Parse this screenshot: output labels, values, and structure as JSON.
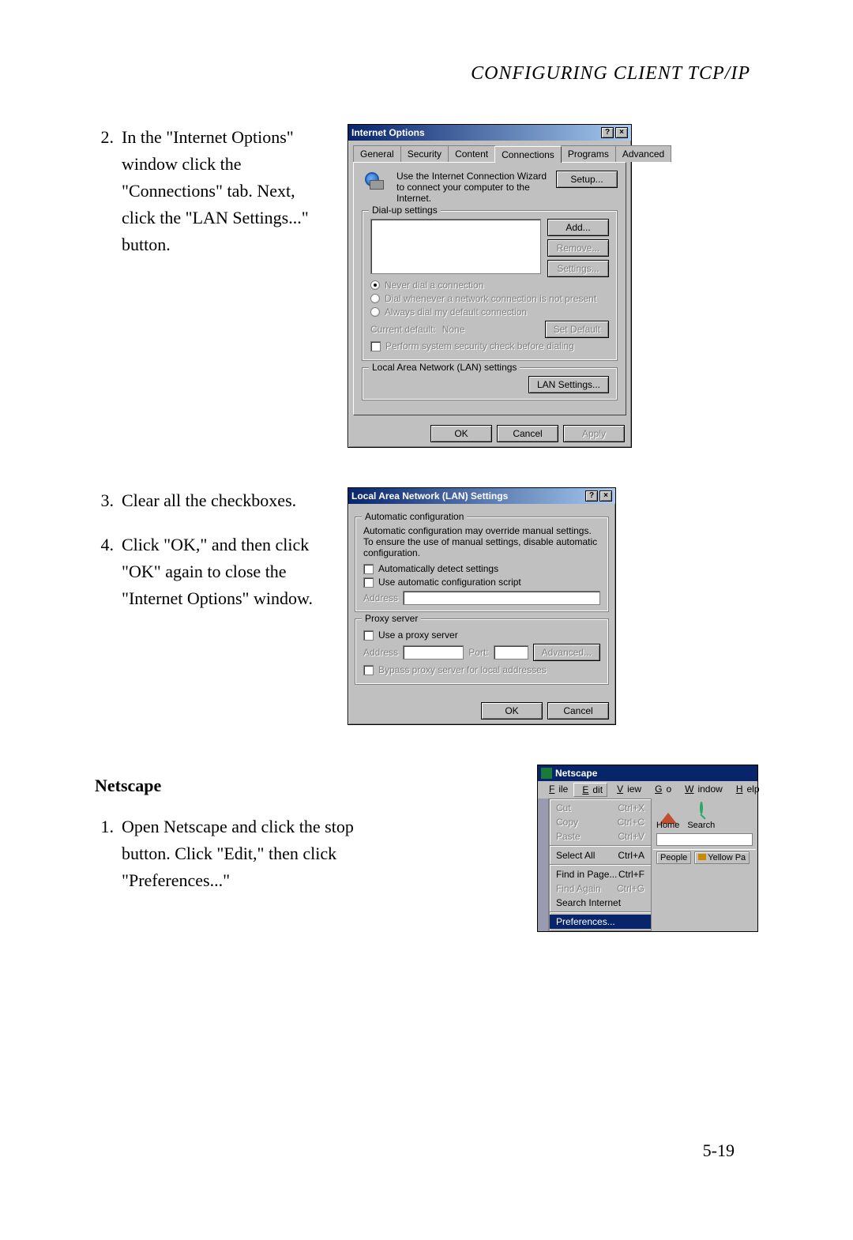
{
  "page": {
    "running_head": "CONFIGURING CLIENT TCP/IP",
    "number": "5-19"
  },
  "steps_a": [
    {
      "n": "2.",
      "text": "In the \"Internet Options\" window click the \"Connections\" tab. Next, click the \"LAN Settings...\" button."
    }
  ],
  "steps_b": [
    {
      "n": "3.",
      "text": "Clear all the checkboxes."
    },
    {
      "n": "4.",
      "text": "Click \"OK,\" and then click \"OK\" again to close the \"Internet Options\" window."
    }
  ],
  "netscape": {
    "heading": "Netscape",
    "steps": [
      {
        "n": "1.",
        "text": "Open Netscape and click the stop button. Click \"Edit,\" then click \"Preferences...\""
      }
    ]
  },
  "dlg1": {
    "title": "Internet Options",
    "tabs": [
      "General",
      "Security",
      "Content",
      "Connections",
      "Programs",
      "Advanced"
    ],
    "active_tab": "Connections",
    "wizard_text": "Use the Internet Connection Wizard to connect your computer to the Internet.",
    "setup_btn": "Setup...",
    "dialup_legend": "Dial-up settings",
    "add_btn": "Add...",
    "remove_btn": "Remove...",
    "settings_btn": "Settings...",
    "radio1": "Never dial a connection",
    "radio2": "Dial whenever a network connection is not present",
    "radio3": "Always dial my default connection",
    "current_default_label": "Current default:",
    "current_default_value": "None",
    "set_default_btn": "Set Default",
    "perform_check": "Perform system security check before dialing",
    "lan_legend": "Local Area Network (LAN) settings",
    "lan_btn": "LAN Settings...",
    "ok": "OK",
    "cancel": "Cancel",
    "apply": "Apply"
  },
  "dlg2": {
    "title": "Local Area Network (LAN) Settings",
    "auto_legend": "Automatic configuration",
    "auto_text": "Automatic configuration may override manual settings. To ensure the use of manual settings, disable automatic configuration.",
    "auto_detect": "Automatically detect settings",
    "auto_script": "Use automatic configuration script",
    "address_label": "Address",
    "proxy_legend": "Proxy server",
    "use_proxy": "Use a proxy server",
    "port_label": "Port:",
    "advanced_btn": "Advanced...",
    "bypass": "Bypass proxy server for local addresses",
    "ok": "OK",
    "cancel": "Cancel"
  },
  "ns": {
    "title": "Netscape",
    "menubar": [
      "File",
      "Edit",
      "View",
      "Go",
      "Window",
      "Help"
    ],
    "menu": {
      "cut": {
        "label": "Cut",
        "accel": "Ctrl+X",
        "enabled": false
      },
      "copy": {
        "label": "Copy",
        "accel": "Ctrl+C",
        "enabled": false
      },
      "paste": {
        "label": "Paste",
        "accel": "Ctrl+V",
        "enabled": false
      },
      "selall": {
        "label": "Select All",
        "accel": "Ctrl+A",
        "enabled": true
      },
      "find": {
        "label": "Find in Page...",
        "accel": "Ctrl+F",
        "enabled": true
      },
      "findagain": {
        "label": "Find Again",
        "accel": "Ctrl+G",
        "enabled": false
      },
      "searchnet": {
        "label": "Search Internet",
        "accel": "",
        "enabled": true
      },
      "prefs": {
        "label": "Preferences...",
        "accel": "",
        "enabled": true
      }
    },
    "tb_home": "Home",
    "tb_search": "Search",
    "link_people": "People",
    "link_yellow": "Yellow Pa"
  }
}
